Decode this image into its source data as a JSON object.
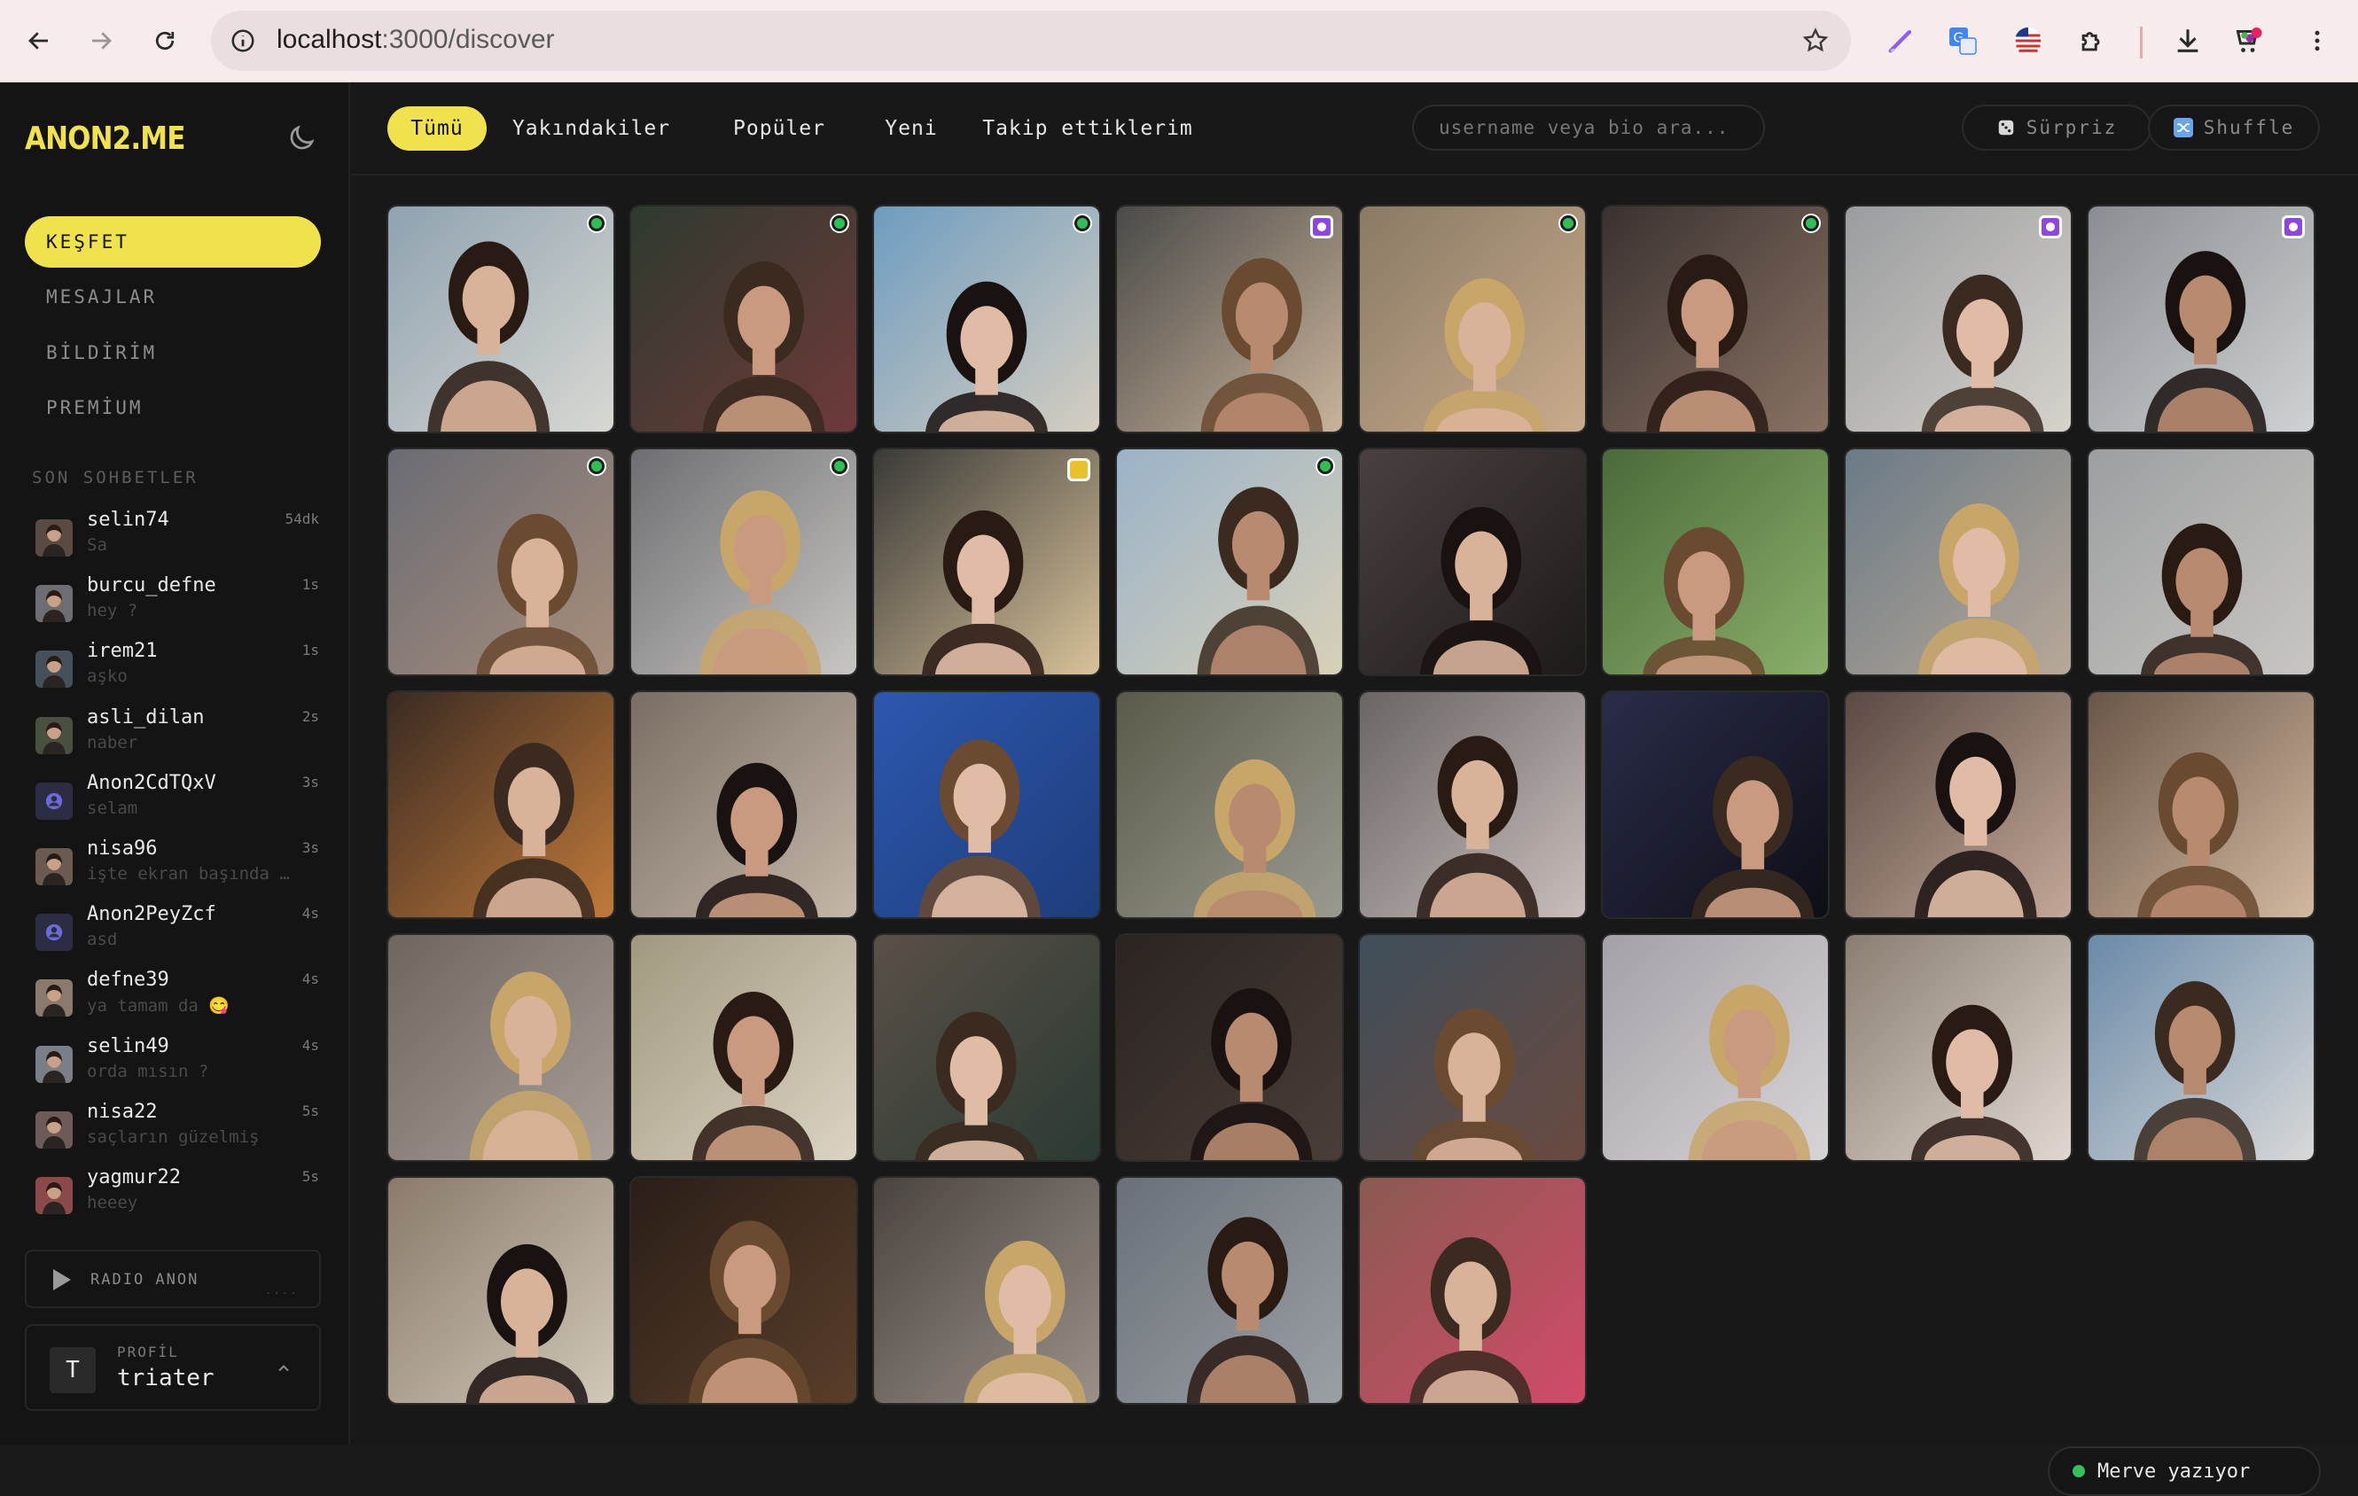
{
  "browser": {
    "url_host": "localhost",
    "url_rest": ":3000/discover"
  },
  "sidebar": {
    "logo": "ANON2.ME",
    "nav": [
      {
        "label": "KEŞFET",
        "active": true
      },
      {
        "label": "MESAJLAR",
        "active": false
      },
      {
        "label": "BİLDİRİM",
        "active": false
      },
      {
        "label": "PREMİUM",
        "active": false
      }
    ],
    "recent_label": "SON SOHBETLER",
    "chats": [
      {
        "name": "selin74",
        "message": "Sa",
        "time": "54dk"
      },
      {
        "name": "burcu_defne",
        "message": "hey ?",
        "time": "1s"
      },
      {
        "name": "irem21",
        "message": "aşko",
        "time": "1s"
      },
      {
        "name": "asli_dilan",
        "message": "naber",
        "time": "2s"
      },
      {
        "name": "Anon2CdTQxV",
        "message": "selam",
        "time": "3s"
      },
      {
        "name": "nisa96",
        "message": "işte ekran başında …",
        "time": "3s"
      },
      {
        "name": "Anon2PeyZcf",
        "message": "asd",
        "time": "4s"
      },
      {
        "name": "defne39",
        "message": "ya tamam da 😋",
        "time": "4s"
      },
      {
        "name": "selin49",
        "message": "orda mısın ?",
        "time": "4s"
      },
      {
        "name": "nisa22",
        "message": "saçların güzelmiş",
        "time": "5s"
      },
      {
        "name": "yagmur22",
        "message": "heeey",
        "time": "5s"
      }
    ],
    "radio_label": "RADIO ANON",
    "radio_dots": "....",
    "profile_label": "PROFİL",
    "profile_initial": "T",
    "profile_name": "triater"
  },
  "topbar": {
    "tabs": [
      {
        "label": "Tümü",
        "active": true
      },
      {
        "label": "Yakındakiler",
        "active": false
      },
      {
        "label": "Popüler",
        "active": false
      },
      {
        "label": "Yeni",
        "active": false
      },
      {
        "label": "Takip ettiklerim",
        "active": false
      }
    ],
    "search_placeholder": "username veya bio ara...",
    "surprise_label": "Sürpriz",
    "shuffle_label": "Shuffle"
  },
  "grid": {
    "badge_colors": {
      "online": "#2fbf57",
      "premium": "#8e46e0",
      "gold": "#e8c22a"
    },
    "cards": [
      {
        "badge": "online"
      },
      {
        "badge": "online"
      },
      {
        "badge": "online"
      },
      {
        "badge": "premium"
      },
      {
        "badge": "online"
      },
      {
        "badge": "online"
      },
      {
        "badge": "premium"
      },
      {
        "badge": "premium"
      },
      {
        "badge": "online"
      },
      {
        "badge": "online"
      },
      {
        "badge": "gold"
      },
      {
        "badge": "online"
      },
      {
        "badge": ""
      },
      {
        "badge": ""
      },
      {
        "badge": ""
      },
      {
        "badge": ""
      },
      {
        "badge": ""
      },
      {
        "badge": ""
      },
      {
        "badge": ""
      },
      {
        "badge": ""
      },
      {
        "badge": ""
      },
      {
        "badge": ""
      },
      {
        "badge": ""
      },
      {
        "badge": ""
      },
      {
        "badge": ""
      },
      {
        "badge": ""
      },
      {
        "badge": ""
      },
      {
        "badge": ""
      },
      {
        "badge": ""
      },
      {
        "badge": ""
      },
      {
        "badge": ""
      },
      {
        "badge": ""
      },
      {
        "badge": ""
      },
      {
        "badge": ""
      },
      {
        "badge": ""
      },
      {
        "badge": ""
      },
      {
        "badge": ""
      }
    ]
  },
  "toast": {
    "text": "Merve yazıyor"
  },
  "colors": {
    "accent": "#f0e24d",
    "online": "#35c05c"
  }
}
